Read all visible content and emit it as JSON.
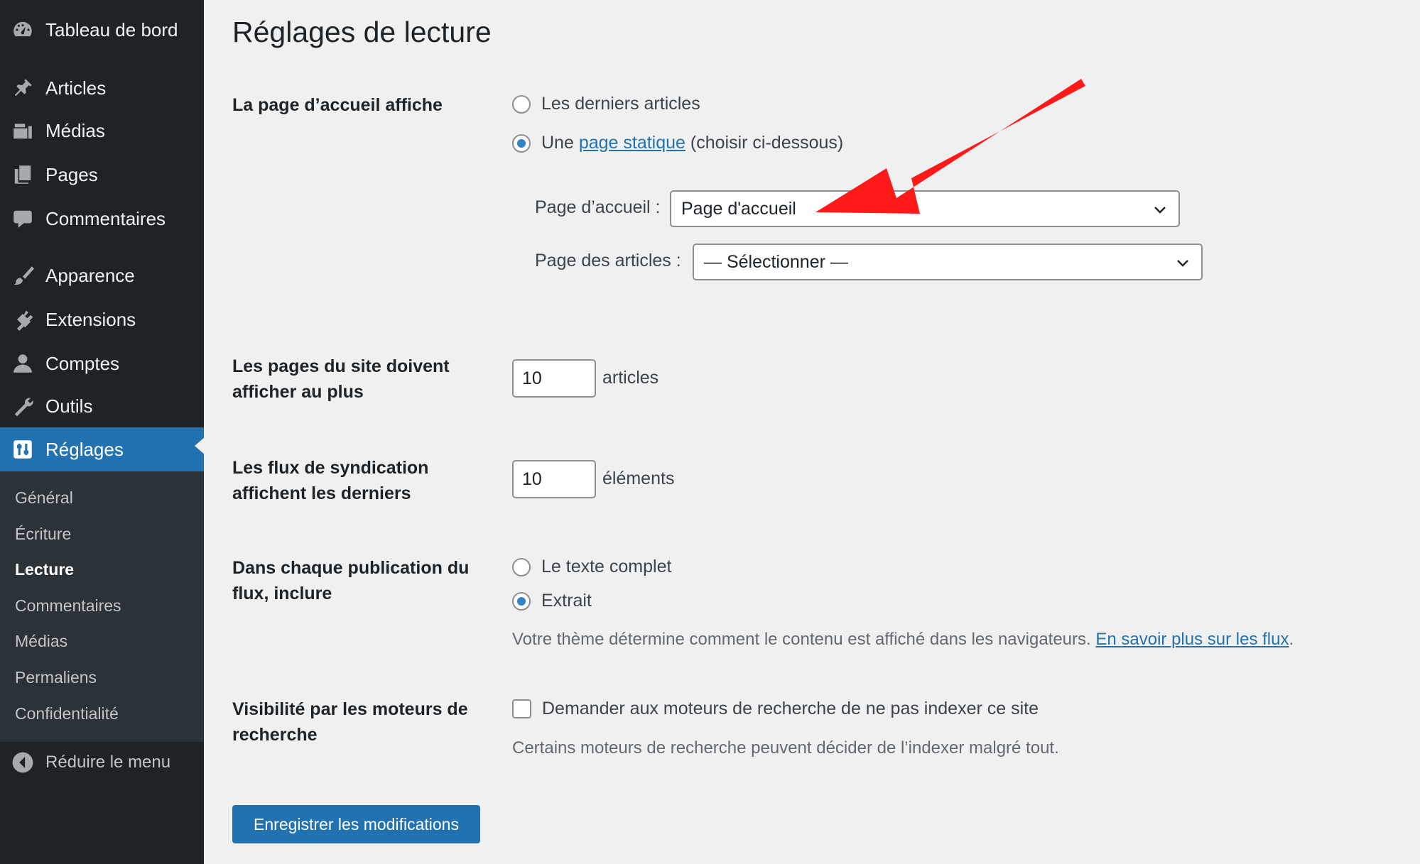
{
  "sidebar": {
    "items": [
      {
        "label": "Tableau de bord",
        "icon": "dashboard-icon"
      },
      {
        "label": "Articles",
        "icon": "pin-icon"
      },
      {
        "label": "Médias",
        "icon": "media-icon"
      },
      {
        "label": "Pages",
        "icon": "pages-icon"
      },
      {
        "label": "Commentaires",
        "icon": "comment-icon"
      },
      {
        "label": "Apparence",
        "icon": "brush-icon"
      },
      {
        "label": "Extensions",
        "icon": "plugin-icon"
      },
      {
        "label": "Comptes",
        "icon": "user-icon"
      },
      {
        "label": "Outils",
        "icon": "wrench-icon"
      },
      {
        "label": "Réglages",
        "icon": "settings-icon",
        "current": true
      }
    ],
    "submenu": [
      "Général",
      "Écriture",
      "Lecture",
      "Commentaires",
      "Médias",
      "Permaliens",
      "Confidentialité"
    ],
    "submenu_active": "Lecture",
    "collapse_label": "Réduire le menu"
  },
  "page": {
    "title": "Réglages de lecture"
  },
  "homepage": {
    "label": "La page d’accueil affiche",
    "option_latest": "Les derniers articles",
    "option_static_prefix": "Une",
    "option_static_link": "page statique",
    "option_static_suffix": "(choisir ci-dessous)",
    "selected": "static",
    "front_label": "Page d’accueil :",
    "front_value": "Page d'accueil",
    "posts_label": "Page des articles :",
    "posts_value": "— Sélectionner —"
  },
  "posts_per_page": {
    "label": "Les pages du site doivent afficher au plus",
    "value": "10",
    "unit": "articles"
  },
  "feed_items": {
    "label": "Les flux de syndication affichent les derniers",
    "value": "10",
    "unit": "éléments"
  },
  "feed_content": {
    "label": "Dans chaque publication du flux, inclure",
    "option_full": "Le texte complet",
    "option_excerpt": "Extrait",
    "selected": "excerpt",
    "description": "Votre thème détermine comment le contenu est affiché dans les navigateurs.",
    "link": "En savoir plus sur les flux",
    "link_suffix": "."
  },
  "visibility": {
    "label": "Visibilité par les moteurs de recherche",
    "checkbox_label": "Demander aux moteurs de recherche de ne pas indexer ce site",
    "checked": false,
    "description": "Certains moteurs de recherche peuvent décider de l’indexer malgré tout."
  },
  "submit_label": "Enregistrer les modifications",
  "colors": {
    "sidebar_bg": "#1d2327",
    "submenu_bg": "#2c3338",
    "accent": "#2271b1",
    "annotation_arrow": "#ff0000"
  }
}
